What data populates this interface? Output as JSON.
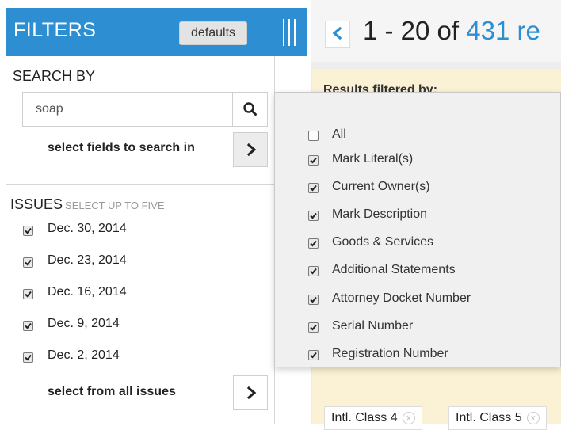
{
  "sidebar": {
    "title": "FILTERS",
    "defaults_label": "defaults",
    "search_by_label": "SEARCH BY",
    "search": {
      "value": "soap",
      "placeholder": ""
    },
    "select_fields_label": "select fields to search in",
    "issues_label": "ISSUES",
    "issues_hint": "SELECT UP TO FIVE",
    "issues": [
      {
        "label": "Dec. 30, 2014",
        "checked": true
      },
      {
        "label": "Dec. 23, 2014",
        "checked": true
      },
      {
        "label": "Dec. 16, 2014",
        "checked": true
      },
      {
        "label": "Dec. 9, 2014",
        "checked": true
      },
      {
        "label": "Dec. 2, 2014",
        "checked": true
      }
    ],
    "select_all_issues_label": "select from all issues"
  },
  "results": {
    "range": "1 - 20 of ",
    "total": "431",
    "tail": " re"
  },
  "filter_summary": {
    "label": "Results filtered by:",
    "chips": [
      "Intl. Class 4",
      "Intl. Class 5"
    ]
  },
  "search_fields": [
    {
      "label": "All",
      "checked": false
    },
    {
      "label": "Mark Literal(s)",
      "checked": true
    },
    {
      "label": "Current Owner(s)",
      "checked": true
    },
    {
      "label": "Mark Description",
      "checked": true
    },
    {
      "label": "Goods & Services",
      "checked": true
    },
    {
      "label": "Additional Statements",
      "checked": true
    },
    {
      "label": "Attorney Docket Number",
      "checked": true
    },
    {
      "label": "Serial Number",
      "checked": true
    },
    {
      "label": "Registration Number",
      "checked": true
    }
  ],
  "colors": {
    "accent": "#2d8fd1",
    "panel_yellow": "#fbf1d4",
    "dropdown_bg": "#f0f0f0"
  },
  "icons": {
    "search": "search-icon",
    "collapse": "collapse-bars-icon",
    "arrow_right": "chevron-right-icon",
    "back": "chevron-left-icon",
    "check": "checkmark-icon",
    "remove": "close-icon"
  }
}
